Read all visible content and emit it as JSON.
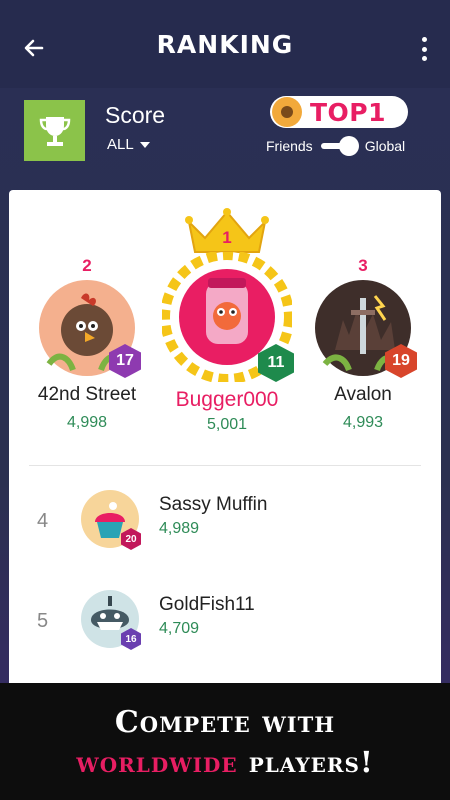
{
  "header": {
    "title": "RANKING",
    "back_icon": "arrow-left-icon",
    "menu_icon": "more-vertical-icon"
  },
  "score_panel": {
    "icon": "trophy-icon",
    "label": "Score",
    "filter_value": "ALL"
  },
  "top_badge": {
    "icon": "sunflower-icon",
    "text": "TOP1"
  },
  "scope_toggle": {
    "left_label": "Friends",
    "right_label": "Global",
    "selected": "Global"
  },
  "podium": [
    {
      "rank": "2",
      "name": "42nd Street",
      "score": "4,998",
      "level": "17",
      "avatar_icon": "rooster-avatar-icon",
      "level_color": "#8e3ab0"
    },
    {
      "rank": "1",
      "name": "Bugger000",
      "score": "5,001",
      "level": "11",
      "avatar_icon": "bug-jar-avatar-icon",
      "level_color": "#1e8a4c"
    },
    {
      "rank": "3",
      "name": "Avalon",
      "score": "4,993",
      "level": "19",
      "avatar_icon": "sword-avatar-icon",
      "level_color": "#d8452b"
    }
  ],
  "list": [
    {
      "rank": "4",
      "name": "Sassy Muffin",
      "score": "4,989",
      "level": "20",
      "avatar_icon": "cupcake-avatar-icon"
    },
    {
      "rank": "5",
      "name": "GoldFish11",
      "score": "4,709",
      "level": "16",
      "avatar_icon": "shark-avatar-icon"
    }
  ],
  "promo": {
    "line1": "Compete with",
    "line2_highlight": "worldwide",
    "line2_rest": "players!"
  },
  "colors": {
    "accent": "#e81e63",
    "score_green": "#2e8b57",
    "header_bg": "#262b4e",
    "trophy_bg": "#8bc34a"
  }
}
